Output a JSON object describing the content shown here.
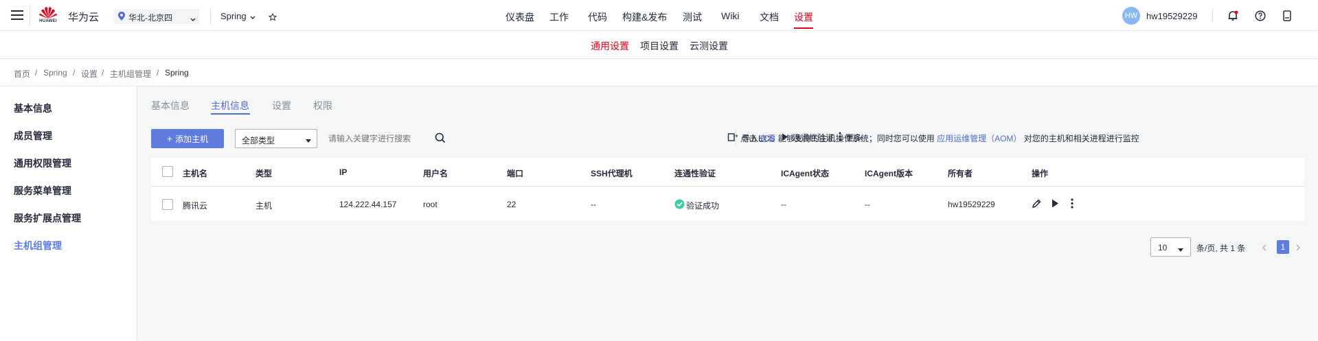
{
  "header": {
    "brand": "华为云",
    "logo_text": "HUAWEI",
    "region": "华北-北京四",
    "project": "Spring",
    "nav": [
      "仪表盘",
      "工作",
      "代码",
      "构建&发布",
      "测试",
      "Wiki",
      "文档",
      "设置"
    ],
    "active_nav": "设置",
    "avatar_initials": "HW",
    "username": "hw19529229"
  },
  "subnav": {
    "items": [
      "通用设置",
      "项目设置",
      "云测设置"
    ],
    "active": "通用设置"
  },
  "breadcrumb": [
    "首页",
    "Spring",
    "设置",
    "主机组管理",
    "Spring"
  ],
  "sidebar": {
    "items": [
      "基本信息",
      "成员管理",
      "通用权限管理",
      "服务菜单管理",
      "服务扩展点管理",
      "主机组管理"
    ],
    "active": "主机组管理"
  },
  "tabs": {
    "items": [
      "基本信息",
      "主机信息",
      "设置",
      "权限"
    ],
    "active": "主机信息"
  },
  "toolbar": {
    "add_host": "添加主机",
    "type_select": "全部类型",
    "search_placeholder": "请输入关键字进行搜索",
    "import_ecs": "导入ECS",
    "connectivity": "连通性验证",
    "more": "更多",
    "hint_prefix": "点击",
    "hint_link": "查看",
    "hint_mid": "能够支持的主机操作系统；同时您可以使用",
    "hint_link2": "应用运维管理（AOM）",
    "hint_suffix": "对您的主机和相关进程进行监控"
  },
  "table": {
    "headers": [
      "主机名",
      "类型",
      "IP",
      "用户名",
      "端口",
      "SSH代理机",
      "连通性验证",
      "ICAgent状态",
      "ICAgent版本",
      "所有者",
      "操作"
    ],
    "rows": [
      {
        "hostname": "腾讯云",
        "type": "主机",
        "ip": "124.222.44.157",
        "user": "root",
        "port": "22",
        "ssh_proxy": "--",
        "connectivity": "验证成功",
        "icagent_status": "--",
        "icagent_version": "--",
        "owner": "hw19529229"
      }
    ]
  },
  "pagination": {
    "page_size": "10",
    "summary": "条/页, 共 1 条",
    "current_page": "1"
  },
  "colors": {
    "brand_red": "#e0001b",
    "primary": "#5e7ce0",
    "success": "#3dcca6"
  }
}
